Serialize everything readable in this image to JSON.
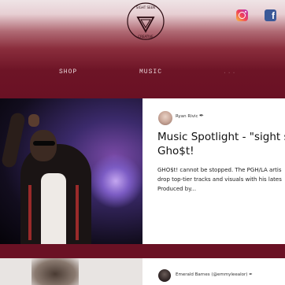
{
  "header": {
    "logo_arc_text_top": "SIGHT SEEN",
    "logo_arc_text_bottom": "CREATIVE",
    "nav": [
      {
        "label": "SHOP"
      },
      {
        "label": "MUSIC"
      },
      {
        "label": "..."
      }
    ],
    "social": {
      "facebook_glyph": "f",
      "instagram_icon": "instagram-icon"
    }
  },
  "colors": {
    "brand_maroon": "#6a1124",
    "header_light": "#efe4e6",
    "instagram": "#ef3f5a",
    "facebook": "#3b5998"
  },
  "post": {
    "author": "Ryan Rivic",
    "author_icon": "feather-icon",
    "title_line1": "Music Spotlight - \"sight se",
    "title_line2": "Gho$t!",
    "excerpt_line1": "GHO$t! cannot be stopped. The PGH/LA artis",
    "excerpt_line2": "drop top-tier tracks and visuals with his lates",
    "excerpt_line3": "Produced by..."
  },
  "post2": {
    "author": "Emerald Barnes (@emmyleealor)",
    "author_icon": "feather-icon"
  }
}
